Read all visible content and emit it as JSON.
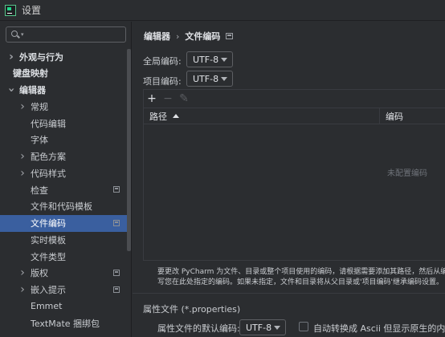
{
  "window": {
    "title": "设置",
    "app_icon": "pycharm-icon"
  },
  "sidebar": {
    "search_placeholder": "",
    "items": [
      {
        "label": "外观与行为",
        "level": 0,
        "expander": "collapsed",
        "bold": true
      },
      {
        "label": "键盘映射",
        "level": 0,
        "expander": "none",
        "bold": true
      },
      {
        "label": "编辑器",
        "level": 0,
        "expander": "expanded",
        "bold": true
      },
      {
        "label": "常规",
        "level": 1,
        "expander": "collapsed"
      },
      {
        "label": "代码编辑",
        "level": 1,
        "expander": "none"
      },
      {
        "label": "字体",
        "level": 1,
        "expander": "none"
      },
      {
        "label": "配色方案",
        "level": 1,
        "expander": "collapsed"
      },
      {
        "label": "代码样式",
        "level": 1,
        "expander": "collapsed"
      },
      {
        "label": "检查",
        "level": 1,
        "expander": "none",
        "project_icon": true
      },
      {
        "label": "文件和代码模板",
        "level": 1,
        "expander": "none"
      },
      {
        "label": "文件编码",
        "level": 1,
        "expander": "none",
        "project_icon": true,
        "selected": true
      },
      {
        "label": "实时模板",
        "level": 1,
        "expander": "none"
      },
      {
        "label": "文件类型",
        "level": 1,
        "expander": "none"
      },
      {
        "label": "版权",
        "level": 1,
        "expander": "collapsed",
        "project_icon": true
      },
      {
        "label": "嵌入提示",
        "level": 1,
        "expander": "collapsed",
        "project_icon": true
      },
      {
        "label": "Emmet",
        "level": 1,
        "expander": "none"
      },
      {
        "label": "TextMate 捆绑包",
        "level": 1,
        "expander": "none"
      }
    ]
  },
  "main": {
    "breadcrumb": {
      "parent": "编辑器",
      "separator": "›",
      "current": "文件编码"
    },
    "global_encoding": {
      "label": "全局编码:",
      "value": "UTF-8"
    },
    "project_encoding": {
      "label": "项目编码:",
      "value": "UTF-8"
    },
    "toolbar": {
      "add": "+",
      "remove": "−",
      "edit": "✎"
    },
    "table": {
      "columns": [
        "路径",
        "编码"
      ],
      "empty_text": "未配置编码"
    },
    "note_lines": [
      "要更改 PyCharm 为文件、目录或整个项目使用的编码，请根据需要添加其路径，然后从编码",
      "写您在此处指定的编码。如果未指定，文件和目录将从父目录或'项目编码'继承编码设置。"
    ],
    "properties": {
      "section_title": "属性文件 (*.properties)",
      "default_label": "属性文件的默认编码:",
      "default_value": "UTF-8",
      "checkbox_label": "自动转换成 Ascii 但显示原生的内容",
      "checkbox_checked": false
    }
  },
  "colors": {
    "background": "#2b2d30",
    "selection": "#3a5f9f",
    "border": "#393b40"
  }
}
